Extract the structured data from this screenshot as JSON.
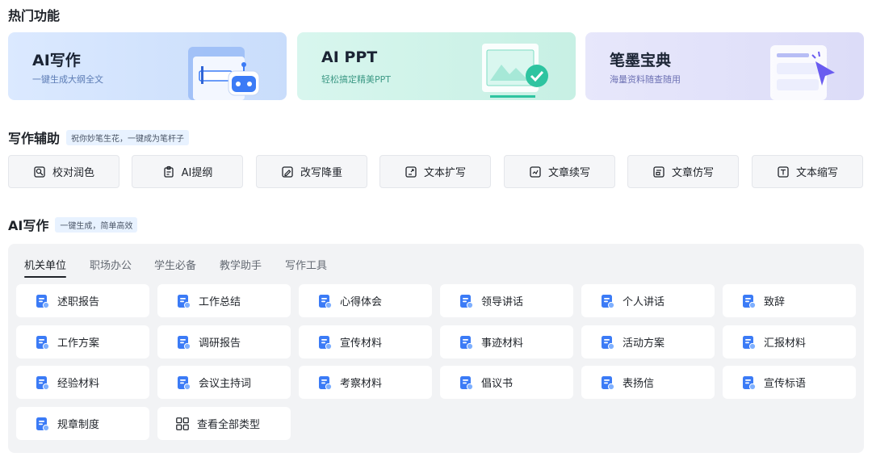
{
  "hot": {
    "title": "热门功能",
    "cards": [
      {
        "title": "AI写作",
        "subtitle": "一键生成大纲全文"
      },
      {
        "title": "AI PPT",
        "subtitle": "轻松搞定精美PPT"
      },
      {
        "title": "笔墨宝典",
        "subtitle": "海量资料随查随用"
      }
    ]
  },
  "assist": {
    "title": "写作辅助",
    "tagline": "祝你妙笔生花，一键成为笔杆子",
    "buttons": [
      {
        "label": "校对润色",
        "icon": "proofread-icon"
      },
      {
        "label": "AI提纲",
        "icon": "clipboard-icon"
      },
      {
        "label": "改写降重",
        "icon": "rewrite-icon"
      },
      {
        "label": "文本扩写",
        "icon": "expand-icon"
      },
      {
        "label": "文章续写",
        "icon": "continue-icon"
      },
      {
        "label": "文章仿写",
        "icon": "imitate-icon"
      },
      {
        "label": "文本缩写",
        "icon": "abbreviate-icon"
      }
    ]
  },
  "aiwrite": {
    "title": "AI写作",
    "tagline": "一键生成，简单高效",
    "tabs": [
      "机关单位",
      "职场办公",
      "学生必备",
      "教学助手",
      "写作工具"
    ],
    "active_tab": 0,
    "items": [
      "述职报告",
      "工作总结",
      "心得体会",
      "领导讲话",
      "个人讲话",
      "致辞",
      "工作方案",
      "调研报告",
      "宣传材料",
      "事迹材料",
      "活动方案",
      "汇报材料",
      "经验材料",
      "会议主持词",
      "考察材料",
      "倡议书",
      "表扬信",
      "宣传标语",
      "规章制度"
    ],
    "view_all": "查看全部类型"
  },
  "colors": {
    "accent_blue": "#3b7bf6",
    "accent_green": "#2ec4a0",
    "accent_purple": "#6a5cf0"
  }
}
